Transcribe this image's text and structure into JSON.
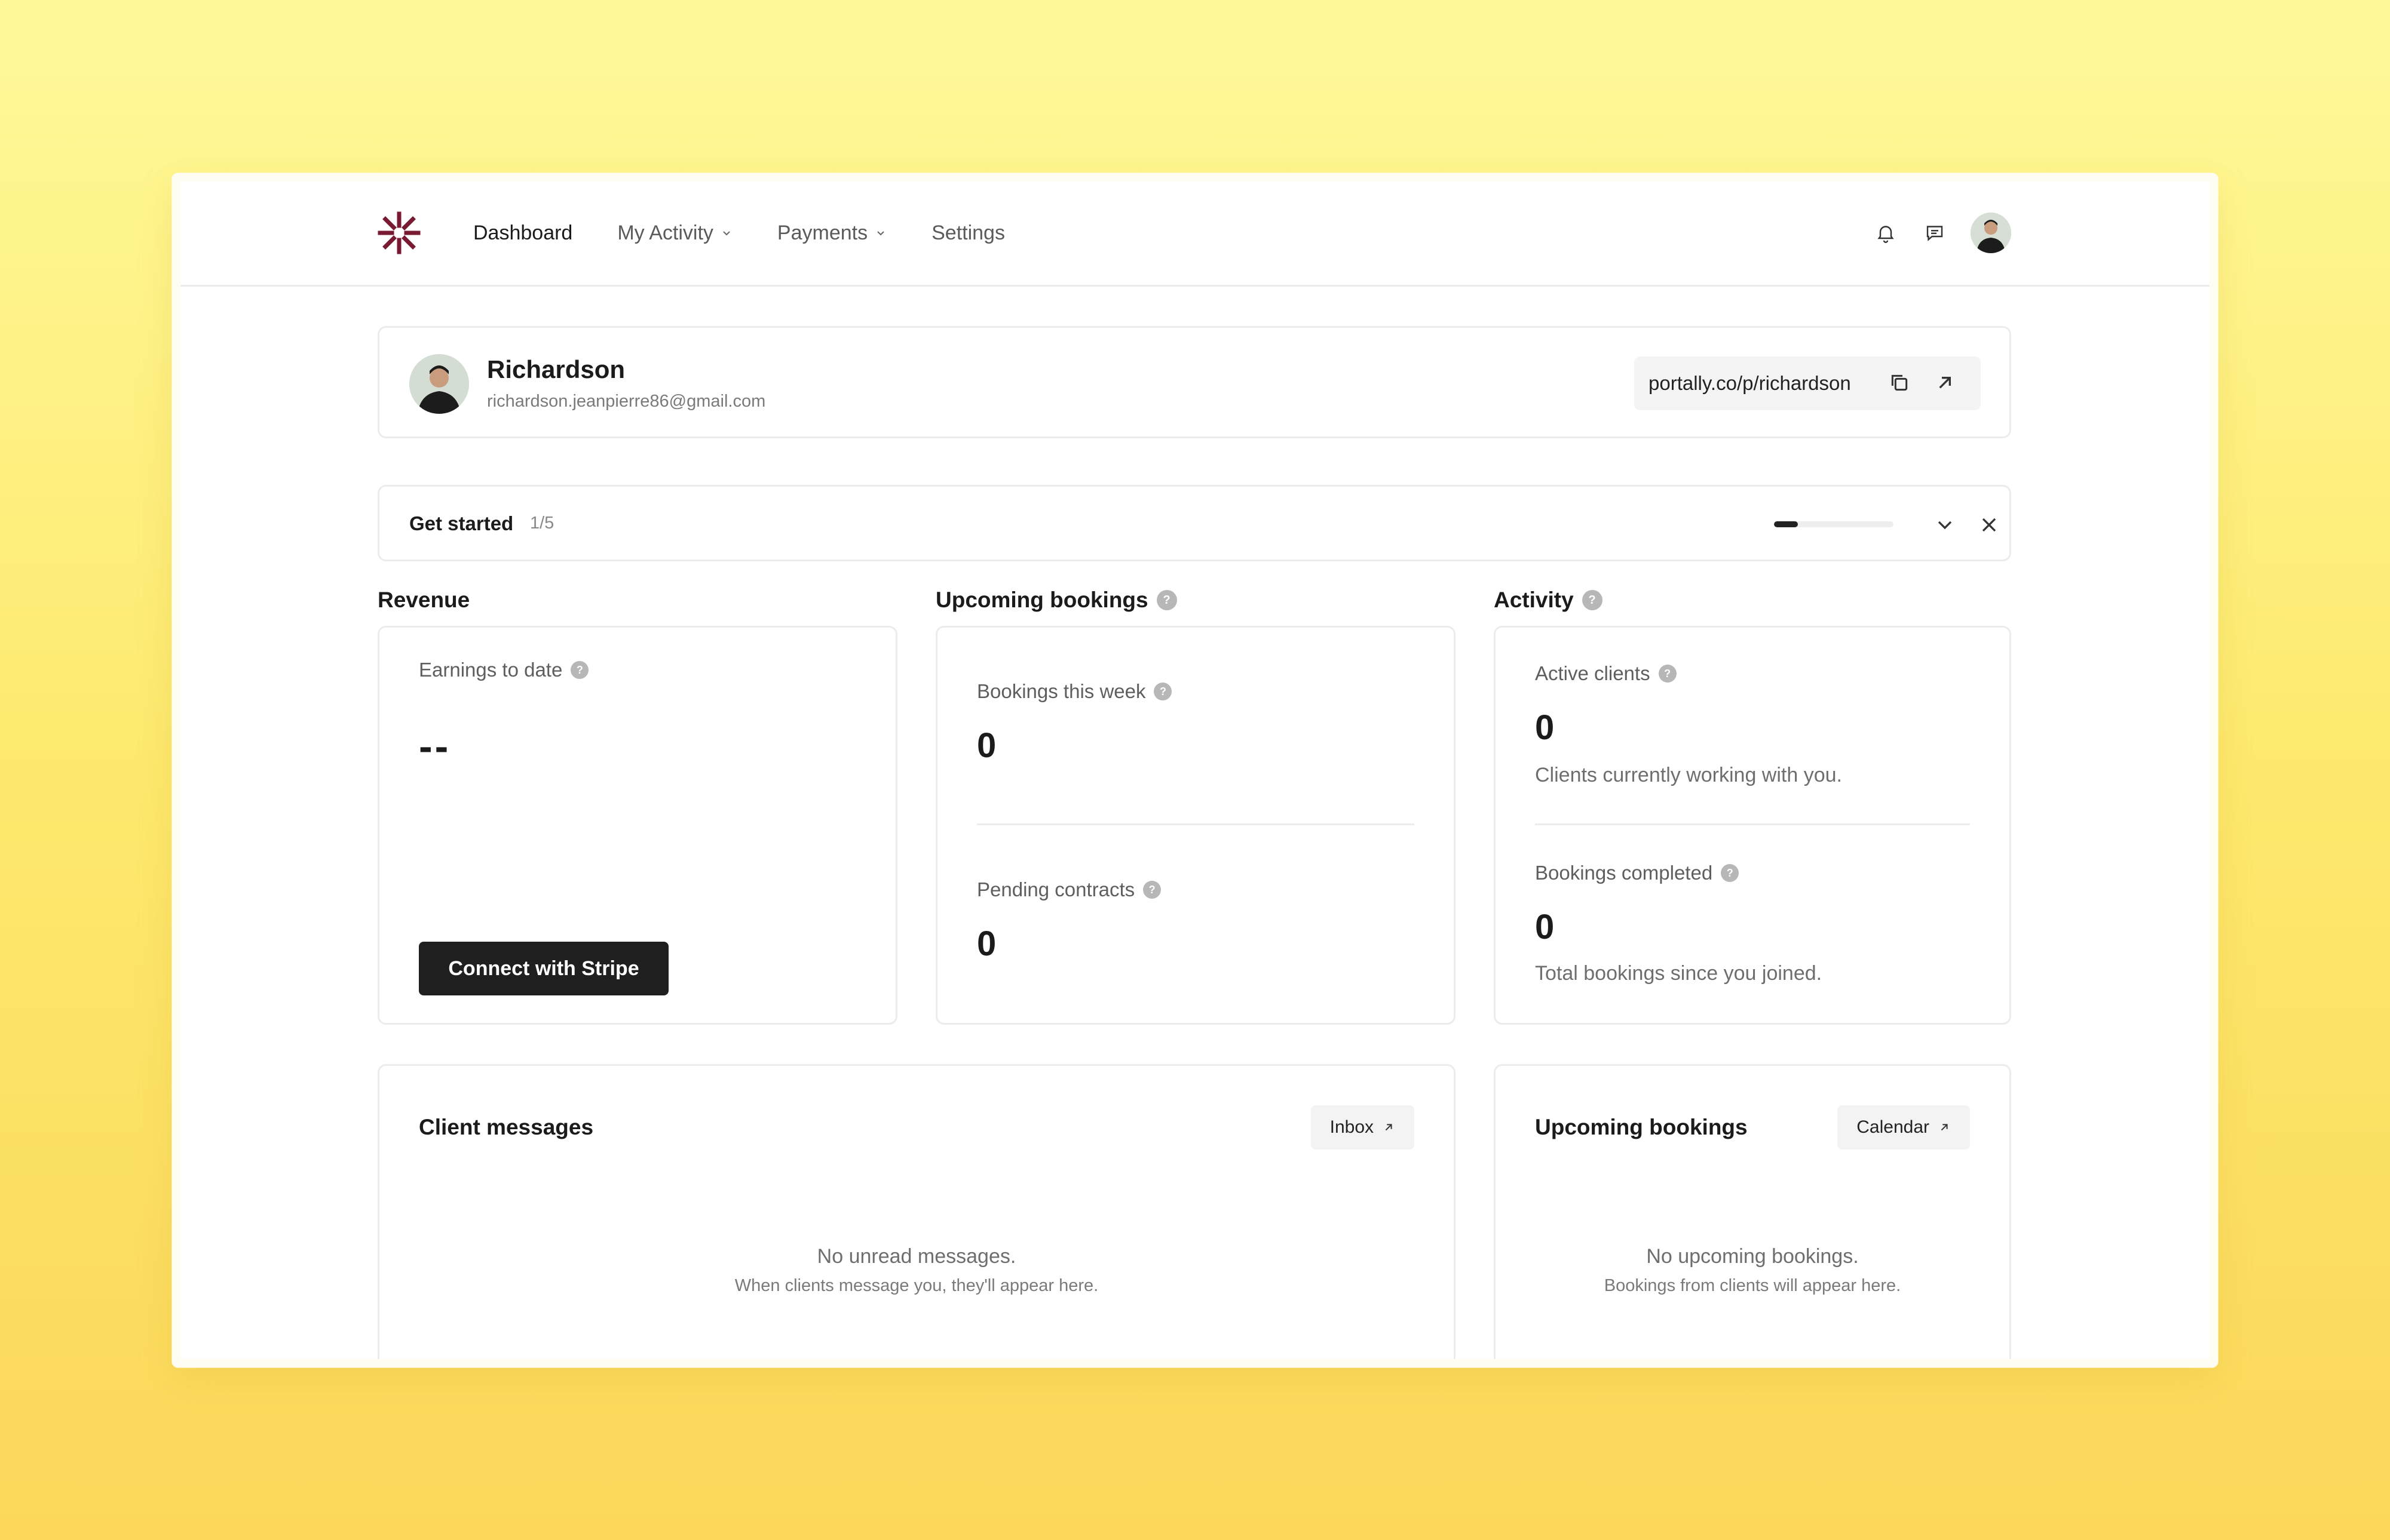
{
  "nav": {
    "items": [
      {
        "label": "Dashboard",
        "active": true,
        "has_dropdown": false
      },
      {
        "label": "My Activity",
        "active": false,
        "has_dropdown": true
      },
      {
        "label": "Payments",
        "active": false,
        "has_dropdown": true
      },
      {
        "label": "Settings",
        "active": false,
        "has_dropdown": false
      }
    ],
    "icons": [
      "bell-icon",
      "chat-icon"
    ]
  },
  "profile": {
    "name": "Richardson",
    "email": "richardson.jeanpierre86@gmail.com",
    "url": "portally.co/p/richardson"
  },
  "get_started": {
    "title": "Get started",
    "count": "1/5",
    "progress": 0.2
  },
  "revenue": {
    "title": "Revenue",
    "earnings_label": "Earnings to date",
    "earnings_value": "--",
    "stripe_button": "Connect with Stripe"
  },
  "upcoming": {
    "title": "Upcoming bookings",
    "week_label": "Bookings this week",
    "week_value": "0",
    "contracts_label": "Pending contracts",
    "contracts_value": "0"
  },
  "activity": {
    "title": "Activity",
    "active_label": "Active clients",
    "active_value": "0",
    "active_desc": "Clients currently working with you.",
    "completed_label": "Bookings completed",
    "completed_value": "0",
    "completed_desc": "Total bookings since you joined."
  },
  "messages": {
    "title": "Client messages",
    "button": "Inbox",
    "empty_main": "No unread messages.",
    "empty_sub": "When clients message you, they'll appear here."
  },
  "upcoming_panel": {
    "title": "Upcoming bookings",
    "button": "Calendar",
    "empty_main": "No upcoming bookings.",
    "empty_sub": "Bookings from clients will appear here."
  },
  "colors": {
    "brand": "#7a1a32",
    "dark_button": "#1f1f1f",
    "background_top": "#fff99a",
    "background_bottom": "#fcd75a"
  }
}
